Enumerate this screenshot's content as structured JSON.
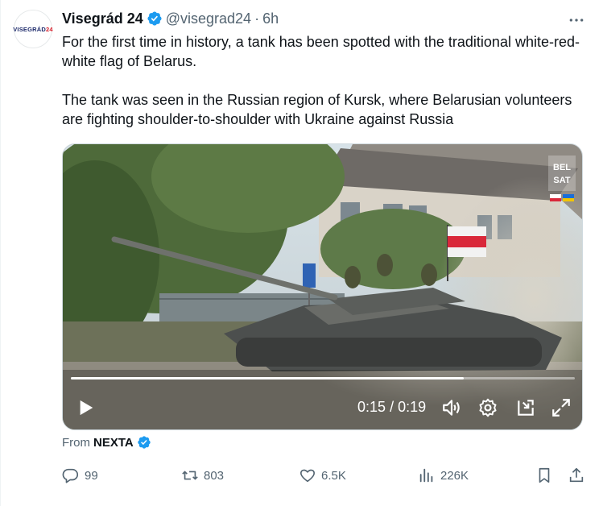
{
  "tweet": {
    "avatar_text_main": "VISEGRÁD",
    "avatar_text_accent": "24",
    "author_name": "Visegrád 24",
    "handle": "@visegrad24",
    "separator": "·",
    "time": "6h",
    "paragraphs": [
      "For the first time in history, a tank has been spotted with the traditional white-red-white flag of Belarus.",
      "The tank was seen in the Russian region of Kursk, where Belarusian volunteers are fighting shoulder-to-shoulder with Ukraine against Russia"
    ]
  },
  "video": {
    "watermark": "BEL SAT",
    "time_current": "0:15",
    "time_separator": "/",
    "time_total": "0:19",
    "progress": 0.78
  },
  "source": {
    "label": "From",
    "name": "NEXTA"
  },
  "actions": {
    "replies": "99",
    "reposts": "803",
    "likes": "6.5K",
    "views": "226K"
  },
  "colors": {
    "verified": "#1d9bf0",
    "icon_gray": "#536471",
    "text": "#0f1419"
  }
}
